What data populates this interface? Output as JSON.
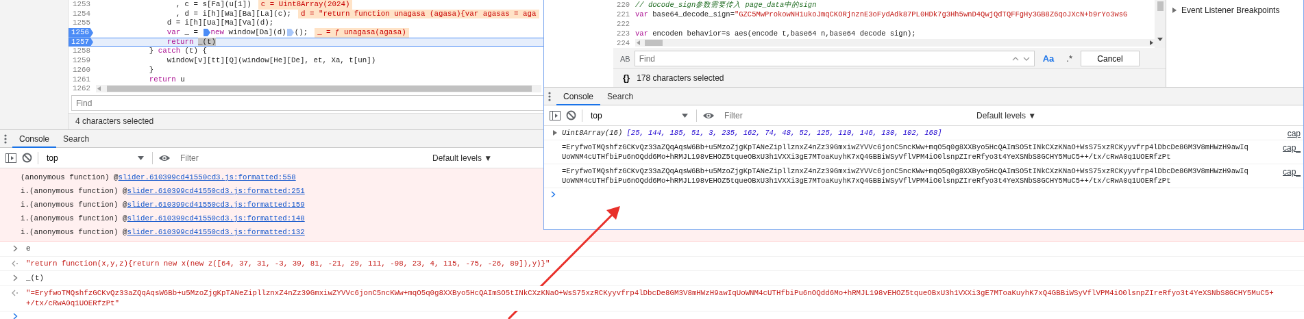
{
  "source": {
    "lines": [
      {
        "number": "1253",
        "breakpoint": false,
        "current": false,
        "segments": [
          {
            "kind": "plain",
            "text": "                  , c = s[Fa](u[1])"
          }
        ],
        "inline_value": "c = Uint8Array(2024)"
      },
      {
        "number": "1254",
        "breakpoint": false,
        "current": false,
        "segments": [
          {
            "kind": "plain",
            "text": "                  , d = i[h][Wa][Ba][La](c);"
          }
        ],
        "inline_value": "d = \"return function unagasa (agasa){var agasas = aga"
      },
      {
        "number": "1255",
        "breakpoint": false,
        "current": false,
        "segments": [
          {
            "kind": "plain",
            "text": "                d = i[h][Ua][Ma][Va](d);"
          }
        ]
      },
      {
        "number": "1256",
        "breakpoint": true,
        "current": false,
        "segments": [
          {
            "kind": "keyword",
            "text": "                var"
          },
          {
            "kind": "plain",
            "text": " _ = "
          },
          {
            "kind": "marker",
            "active": true
          },
          {
            "kind": "keyword",
            "text": "new"
          },
          {
            "kind": "plain",
            "text": " window[Da](d)"
          },
          {
            "kind": "marker",
            "active": false
          },
          {
            "kind": "plain",
            "text": "();"
          }
        ],
        "inline_value": "_ = ƒ unagasa(agasa)"
      },
      {
        "number": "1257",
        "breakpoint": true,
        "current": true,
        "segments": [
          {
            "kind": "keyword",
            "text": "                return"
          },
          {
            "kind": "selected",
            "text": "_(t)"
          }
        ]
      },
      {
        "number": "1258",
        "breakpoint": false,
        "current": false,
        "segments": [
          {
            "kind": "plain",
            "text": "            } "
          },
          {
            "kind": "keyword",
            "text": "catch"
          },
          {
            "kind": "plain",
            "text": " (t) {"
          }
        ]
      },
      {
        "number": "1259",
        "breakpoint": false,
        "current": false,
        "segments": [
          {
            "kind": "plain",
            "text": "                window[v][tt][Q](window[He][De], et, Xa, t[un])"
          }
        ]
      },
      {
        "number": "1260",
        "breakpoint": false,
        "current": false,
        "segments": [
          {
            "kind": "plain",
            "text": "            }"
          }
        ]
      },
      {
        "number": "1261",
        "breakpoint": false,
        "current": false,
        "segments": [
          {
            "kind": "keyword",
            "text": "            return"
          },
          {
            "kind": "plain",
            "text": " u"
          }
        ]
      },
      {
        "number": "1262",
        "breakpoint": false,
        "current": false
      }
    ],
    "find": {
      "placeholder": "Find"
    },
    "status": "4 characters selected"
  },
  "console": {
    "tabs": [
      {
        "label": "Console",
        "selected": true
      },
      {
        "label": "Search",
        "selected": false
      }
    ],
    "context": "top",
    "filter": {
      "placeholder": "Filter"
    },
    "levels": "Default levels ▼",
    "stack": [
      {
        "function": "(anonymous function)",
        "at": "@",
        "link": "slider.610399cd41550cd3.js:formatted:558"
      },
      {
        "function": "i.(anonymous function)",
        "at": "@",
        "link": "slider.610399cd41550cd3.js:formatted:251"
      },
      {
        "function": "i.(anonymous function)",
        "at": "@",
        "link": "slider.610399cd41550cd3.js:formatted:159"
      },
      {
        "function": "i.(anonymous function)",
        "at": "@",
        "link": "slider.610399cd41550cd3.js:formatted:148"
      },
      {
        "function": "i.(anonymous function)",
        "at": "@",
        "link": "slider.610399cd41550cd3.js:formatted:132"
      }
    ],
    "entries": [
      {
        "kind": "input",
        "lines": [
          "e"
        ]
      },
      {
        "kind": "result",
        "lines": [
          "\"return function(x,y,z){return new x(new z([64, 37, 31, -3, 39, 81, -21, 29, 111, -98, 23, 4, 115, -75, -26, 89]),y)}\""
        ]
      },
      {
        "kind": "input",
        "lines": [
          "_(t)"
        ]
      },
      {
        "kind": "result",
        "lines": [
          "\"=EryfwoTMQshfzGCKvQz33aZQqAqsW6Bb+u5MzoZjgKpTANeZipllznxZ4nZz39GmxiwZYVVc6jonC5ncKWw+mqO5q0g8XXByo5HcQAImSO5tINkCXzKNaO+WsS75xzRCKyyvfrp4lDbcDe8GM3V8mHWzH9awIqUoWNM4cUTHfbiPu6nOQdd6Mo+hRMJL198vEHOZ5tqueOBxU3h1VXXi3gE7MToaKuyhK7xQ4GBBiWSyVflVPM4iO0lsnpZIreRfyo3t4YeXSNbS8GCHY5MuC5+",
          "+/tx/cRwA0q1UOERfzPt\""
        ]
      }
    ]
  },
  "popup": {
    "editor": {
      "lines": [
        {
          "number": "220",
          "breakpoint": false,
          "current": false,
          "segments": [
            {
              "kind": "comment",
              "text": "// docode_sign参数需要传入 page_data中的sign"
            }
          ]
        },
        {
          "number": "221",
          "breakpoint": false,
          "current": false,
          "segments": [
            {
              "kind": "keyword",
              "text": "var"
            },
            {
              "kind": "plain",
              "text": " base64_decode_sign="
            },
            {
              "kind": "string",
              "text": "\"GZC5MwProkowNH1ukoJmqCKORjnznE3oFydAdk87PL0HDk7g3Hh5wnD4QwjQdTQFFgHy3GB8Z6qoJXcN+b9rYo3wsG"
            }
          ]
        },
        {
          "number": "222",
          "breakpoint": false,
          "current": false
        },
        {
          "number": "223",
          "breakpoint": false,
          "current": false,
          "segments": [
            {
              "kind": "keyword",
              "text": "var"
            },
            {
              "kind": "plain",
              "text": " encoden behavior=s aes(encode t,base64 n,base64 decode sign);"
            }
          ]
        },
        {
          "number": "224",
          "breakpoint": false,
          "current": false
        }
      ]
    },
    "sidebar": {
      "items": [
        {
          "label": "Event Listener Breakpoints",
          "expanded": false
        }
      ]
    },
    "find": {
      "replace_toggle": "AB",
      "placeholder": "Find",
      "match_case": {
        "label": "Aa",
        "on": true
      },
      "regex": {
        "label": ".*",
        "on": false
      },
      "cancel": "Cancel"
    },
    "status": {
      "format": "{}",
      "text": "178 characters selected"
    },
    "console": {
      "tabs": [
        {
          "label": "Console",
          "selected": true
        },
        {
          "label": "Search",
          "selected": false
        }
      ],
      "context": "top",
      "filter": {
        "placeholder": "Filter"
      },
      "levels": "Default levels ▼",
      "messages": [
        {
          "kind": "typed_array",
          "expanded": false,
          "label": "Uint8Array(16)",
          "values": "[25, 144, 185, 51, 3, 235, 162, 74, 48, 52, 125, 110, 146, 130, 102, 168]",
          "source": "cap"
        },
        {
          "kind": "text",
          "lines": [
            "=EryfwoTMQshfzGCKvQz33aZQqAqsW6Bb+u5MzoZjgKpTANeZipllznxZ4nZz39GmxiwZYVVc6jonC5ncKWw+mqO5q0g8XXByo5HcQAImSO5tINkCXzKNaO+WsS75xzRCKyyvfrp4lDbcDe8GM3V8mHWzH9awIq",
            "UoWNM4cUTHfbiPu6nOQdd6Mo+hRMJL198vEHOZ5tqueOBxU3h1VXXi3gE7MToaKuyhK7xQ4GBBiWSyVflVPM4iO0lsnpZIreRfyo3t4YeXSNbS8GCHY5MuC5++/tx/cRwA0q1UOERfzPt"
          ],
          "source": "cap_"
        },
        {
          "kind": "text",
          "lines": [
            "=EryfwoTMQshfzGCKvQz33aZQqAqsW6Bb+u5MzoZjgKpTANeZipllznxZ4nZz39GmxiwZYVVc6jonC5ncKWw+mqO5q0g8XXByo5HcQAImSO5tINkCXzKNaO+WsS75xzRCKyyvfrp4lDbcDe8GM3V8mHWzH9awIq",
            "UoWNM4cUTHfbiPu6nOQdd6Mo+hRMJL198vEHOZ5tqueOBxU3h1VXXi3gE7MToaKuyhK7xQ4GBBiWSyVflVPM4iO0lsnpZIreRfyo3t4YeXSNbS8GCHY5MuC5++/tx/cRwA0q1UOERfzPt"
          ],
          "source": "cap_"
        }
      ]
    }
  }
}
